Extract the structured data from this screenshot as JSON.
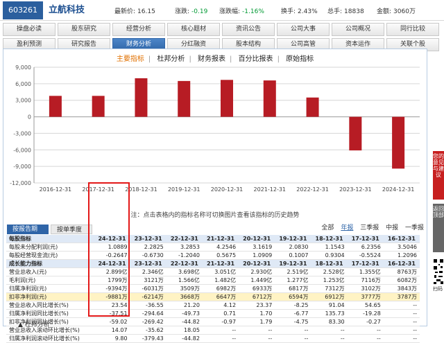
{
  "stock": {
    "code": "603261",
    "name": "立航科技",
    "fields": [
      {
        "label": "最新价:",
        "value": "16.15",
        "green": false
      },
      {
        "label": "涨跌:",
        "value": "-0.19",
        "green": true
      },
      {
        "label": "涨跌幅:",
        "value": "-1.16%",
        "green": true
      },
      {
        "label": "换手:",
        "value": "2.43%",
        "green": false
      },
      {
        "label": "总手:",
        "value": "18838",
        "green": false
      },
      {
        "label": "金额:",
        "value": "3060万",
        "green": false
      }
    ]
  },
  "tabs": {
    "row1": [
      "操盘必读",
      "股东研究",
      "经营分析",
      "核心题材",
      "资讯公告",
      "公司大事",
      "公司概况",
      "同行比较"
    ],
    "row2": [
      "盈利预测",
      "研究报告",
      "财务分析",
      "分红融资",
      "股本结构",
      "公司高管",
      "资本运作",
      "关联个股"
    ],
    "active": "财务分析"
  },
  "subnav": {
    "items": [
      "主要指标",
      "杜邦分析",
      "财务报表",
      "百分比报表",
      "原始指标"
    ],
    "active": "主要指标"
  },
  "chart_data": {
    "type": "bar",
    "categories": [
      "2016-12-31",
      "2017-12-31",
      "2018-12-31",
      "2019-12-31",
      "2020-12-31",
      "2021-12-31",
      "2022-12-31",
      "2023-12-31",
      "2024-12-31"
    ],
    "values": [
      3800,
      3800,
      7000,
      6500,
      6700,
      6600,
      3500,
      -6100,
      -9400
    ],
    "y_ticks": [
      "9,000",
      "6,000",
      "3,000",
      "0",
      "-3,000",
      "-6,000",
      "-9,000",
      "-12,000"
    ],
    "ylim": [
      -12000,
      9000
    ],
    "color": "#b71c24",
    "grid": true
  },
  "hint": "注：点击表格内的指标名称可切换图片查看该指标的历史趋势",
  "buttons": {
    "by_period": "按报告期",
    "by_single": "按单季度"
  },
  "filters": {
    "items": [
      "全部",
      "年报",
      "三季报",
      "中报",
      "一季报"
    ],
    "selected": "年报"
  },
  "table": {
    "rows": [
      {
        "type": "sec",
        "cells": [
          "每股指标",
          "24-12-31",
          "23-12-31",
          "22-12-31",
          "21-12-31",
          "20-12-31",
          "19-12-31",
          "18-12-31",
          "17-12-31",
          "16-12-31"
        ]
      },
      {
        "type": "row",
        "cells": [
          "每股未分配利润(元)",
          "1.0889",
          "2.2825",
          "3.2853",
          "4.2546",
          "3.1619",
          "2.0830",
          "1.1543",
          "6.2356",
          "3.5046"
        ]
      },
      {
        "type": "row",
        "cells": [
          "每股经营现金流(元)",
          "-0.2647",
          "-0.6730",
          "-1.2040",
          "0.5675",
          "1.0909",
          "0.1007",
          "0.9304",
          "-0.5524",
          "1.2096"
        ]
      },
      {
        "type": "sec",
        "cells": [
          "成长能力指标",
          "24-12-31",
          "23-12-31",
          "22-12-31",
          "21-12-31",
          "20-12-31",
          "19-12-31",
          "18-12-31",
          "17-12-31",
          "16-12-31"
        ]
      },
      {
        "type": "row",
        "cells": [
          "营业总收入(元)",
          "2.899亿",
          "2.346亿",
          "3.698亿",
          "3.051亿",
          "2.930亿",
          "2.519亿",
          "2.528亿",
          "1.355亿",
          "8763万"
        ]
      },
      {
        "type": "row",
        "cells": [
          "毛利润(元)",
          "1799万",
          "3121万",
          "1.566亿",
          "1.482亿",
          "1.449亿",
          "1.277亿",
          "1.253亿",
          "7116万",
          "6082万"
        ]
      },
      {
        "type": "row",
        "cells": [
          "归属净利润(元)",
          "-9394万",
          "-6031万",
          "3509万",
          "6982万",
          "6933万",
          "6817万",
          "7312万",
          "3102万",
          "3843万"
        ]
      },
      {
        "type": "hl",
        "cells": [
          "扣非净利润(元)",
          "-9881万",
          "-6214万",
          "3668万",
          "6647万",
          "6712万",
          "6594万",
          "6912万",
          "3777万",
          "3787万"
        ]
      },
      {
        "type": "row",
        "cells": [
          "营业总收入同比增长(%)",
          "23.54",
          "-36.55",
          "21.20",
          "4.12",
          "23.37",
          "-8.25",
          "91.04",
          "54.65",
          "--"
        ]
      },
      {
        "type": "row",
        "cells": [
          "归属净利润同比增长(%)",
          "-37.51",
          "-294.64",
          "-49.73",
          "0.71",
          "1.70",
          "-6.77",
          "135.73",
          "-19.28",
          "--"
        ]
      },
      {
        "type": "row",
        "cells": [
          "扣非净利润同比增长(%)",
          "-59.02",
          "-269.42",
          "-44.82",
          "-0.97",
          "1.79",
          "-4.75",
          "83.30",
          "-0.27",
          "--"
        ]
      },
      {
        "type": "row",
        "cells": [
          "营业总收入滚动环比增长(%)",
          "14.07",
          "-35.62",
          "18.05",
          "--",
          "--",
          "--",
          "--",
          "--",
          "--"
        ]
      },
      {
        "type": "row",
        "cells": [
          "归属净利润滚动环比增长(%)",
          "9.80",
          "-379.43",
          "-44.82",
          "--",
          "--",
          "--",
          "--",
          "--",
          "--"
        ]
      }
    ]
  },
  "sidebar": {
    "feedback": "您的意见与建议",
    "back_top": "返回顶部",
    "scan": "扫码"
  },
  "bottom": {
    "title": "杜邦分析"
  }
}
